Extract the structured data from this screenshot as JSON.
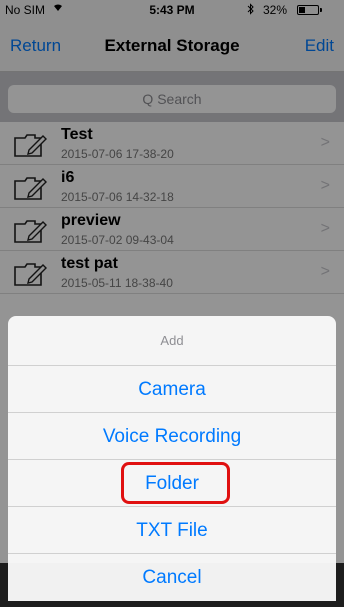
{
  "status_bar": {
    "carrier": "No SIM",
    "wifi_icon": "wifi-icon",
    "time": "5:43 PM",
    "bluetooth_icon": "bluetooth-icon",
    "battery_text": "32%",
    "battery_level": 0.32
  },
  "nav": {
    "left_label": "Return",
    "title": "External Storage",
    "right_label": "Edit"
  },
  "search": {
    "placeholder": "Q Search"
  },
  "files": [
    {
      "name": "Test",
      "date": "2015-07-06 17-38-20"
    },
    {
      "name": "i6",
      "date": "2015-07-06 14-32-18"
    },
    {
      "name": "preview",
      "date": "2015-07-02 09-43-04"
    },
    {
      "name": "test pat",
      "date": "2015-05-11 18-38-40"
    }
  ],
  "action_sheet": {
    "title": "Add",
    "options": [
      "Camera",
      "Voice Recording",
      "Folder",
      "TXT File"
    ],
    "cancel": "Cancel",
    "highlighted": "Folder"
  },
  "colors": {
    "accent": "#007aff",
    "highlight": "#e01010"
  }
}
